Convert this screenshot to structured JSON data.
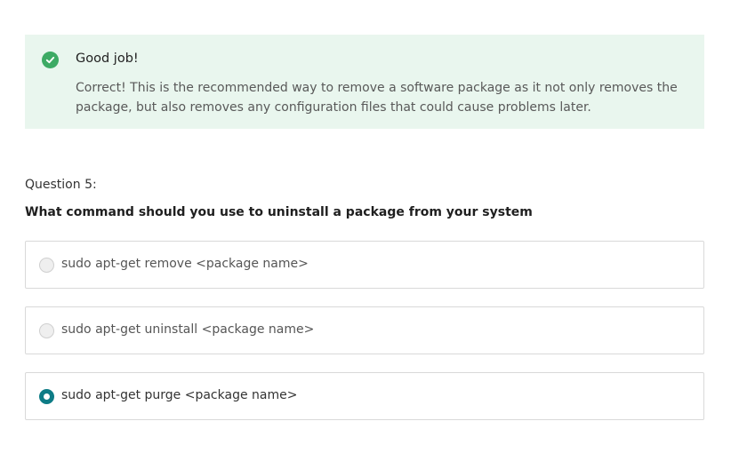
{
  "feedback": {
    "icon": "check-circle-icon",
    "title": "Good job!",
    "message": "Correct! This is the recommended way to remove a software package as it not only removes the package, but also removes any configuration files that could cause problems later.",
    "background_color": "#e9f6ee",
    "icon_color": "#3daa64"
  },
  "question": {
    "number_label": "Question 5:",
    "text": "What command should you use to uninstall a package from your system",
    "options": [
      {
        "label": "sudo apt-get remove <package name>",
        "selected": false
      },
      {
        "label": "sudo apt-get uninstall <package name>",
        "selected": false
      },
      {
        "label": "sudo apt-get purge <package name>",
        "selected": true
      }
    ],
    "accent_color": "#0e7c86"
  }
}
